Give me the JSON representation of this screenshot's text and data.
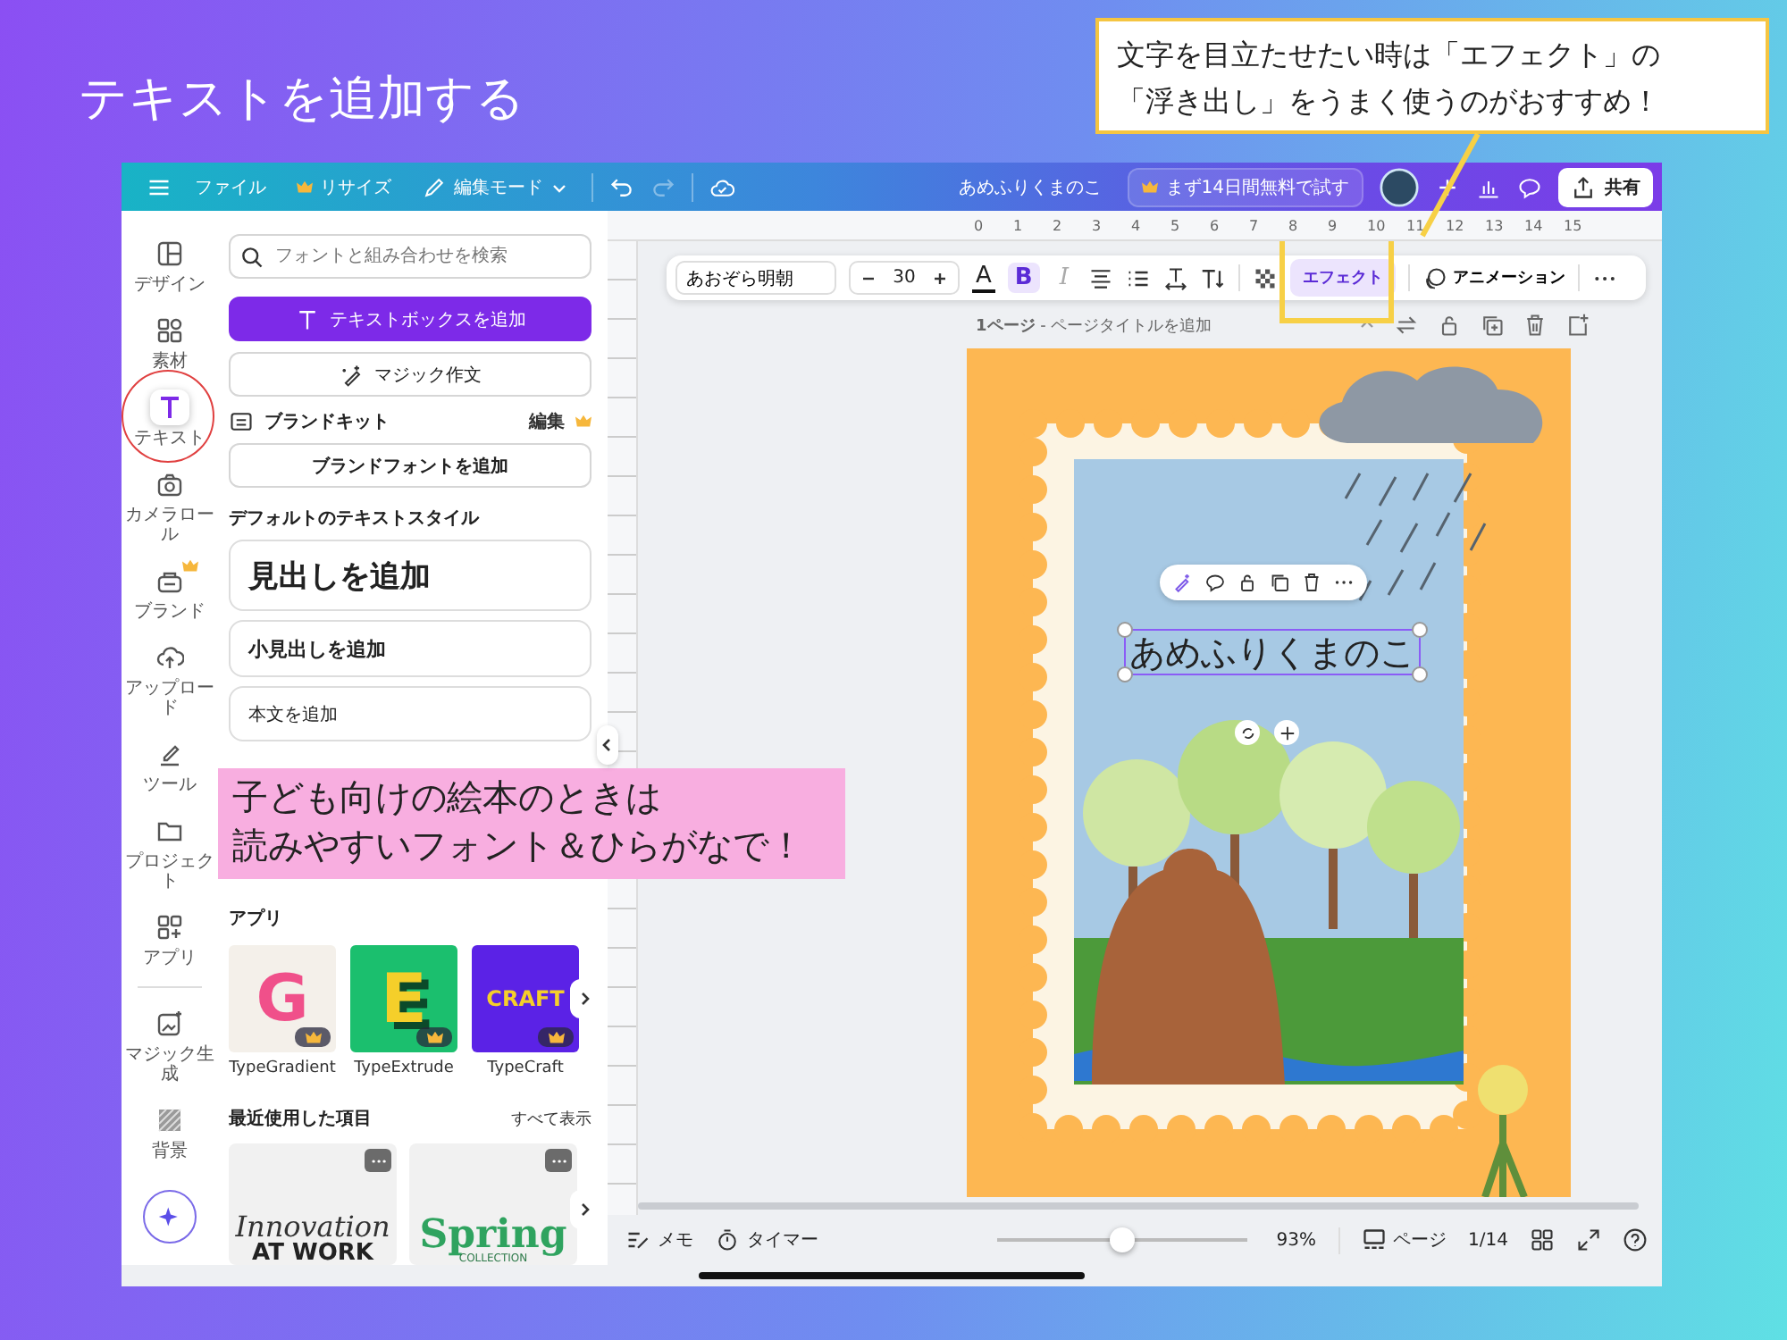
{
  "heading": "テキストを追加する",
  "callout": [
    "文字を目立たせたい時は「エフェクト」の",
    "「浮き出し」をうまく使うのがおすすめ！"
  ],
  "note": [
    "子ども向けの絵本のときは",
    "読みやすいフォント＆ひらがなで！"
  ],
  "topbar": {
    "menu": [
      {
        "label": "ファイル",
        "crown": false
      },
      {
        "label": "リサイズ",
        "crown": true
      }
    ],
    "mode": "編集モード",
    "doc_title": "あめふりくまのこ",
    "trial": "まず14日間無料で試す",
    "share": "共有"
  },
  "rail": [
    {
      "label": "デザイン",
      "kind": "layout",
      "selected": false,
      "crown": false,
      "circled": false
    },
    {
      "label": "素材",
      "kind": "elements",
      "selected": false,
      "crown": false,
      "circled": false
    },
    {
      "label": "テキスト",
      "kind": "text",
      "selected": true,
      "crown": false,
      "circled": true
    },
    {
      "label": "カメラロール",
      "kind": "camera",
      "selected": false,
      "crown": false,
      "circled": false
    },
    {
      "label": "ブランド",
      "kind": "brand",
      "selected": false,
      "crown": true,
      "circled": false
    },
    {
      "label": "アップロード",
      "kind": "upload",
      "selected": false,
      "crown": false,
      "circled": false
    },
    {
      "label": "ツール",
      "kind": "tools",
      "selected": false,
      "crown": false,
      "circled": false
    },
    {
      "label": "プロジェクト",
      "kind": "folder",
      "selected": false,
      "crown": false,
      "circled": false
    },
    {
      "label": "アプリ",
      "kind": "apps",
      "selected": false,
      "crown": false,
      "circled": false
    }
  ],
  "rail_extra": [
    {
      "label": "マジック生成",
      "kind": "magic",
      "selected": false,
      "crown": false,
      "circled": false
    },
    {
      "label": "背景",
      "kind": "pattern",
      "selected": false,
      "crown": false,
      "circled": false
    }
  ],
  "panel": {
    "search": {
      "placeholder": "フォントと組み合わせを検索"
    },
    "add_textbox": "テキストボックスを追加",
    "magic_write": "マジック作文",
    "brand_kit": {
      "title": "ブランドキット",
      "edit": "編集",
      "crown": true
    },
    "brand_font": "ブランドフォントを追加",
    "styles_title": "デフォルトのテキストスタイル",
    "styles": [
      {
        "kind": "heading",
        "label": "見出しを追加"
      },
      {
        "kind": "subheading",
        "label": "小見出しを追加"
      },
      {
        "kind": "body",
        "label": "本文を追加"
      }
    ],
    "apps_title": "アプリ",
    "apps": [
      {
        "name": "TypeGradient",
        "kind": "gradient",
        "art": "G",
        "crown": true
      },
      {
        "name": "TypeExtrude",
        "kind": "extrude",
        "art": "E",
        "crown": true
      },
      {
        "name": "TypeCraft",
        "kind": "craft",
        "art": "CRAFT",
        "crown": true
      }
    ],
    "recent_title": "最近使用した項目",
    "see_all": "すべて表示",
    "recent": [
      {
        "kind": "serif",
        "lines": [
          "Innovation",
          "AT WORK"
        ]
      },
      {
        "kind": "spring",
        "lines": [
          "Spring",
          "COLLECTION"
        ]
      }
    ]
  },
  "ruler": [
    "0",
    "1",
    "2",
    "3",
    "4",
    "5",
    "6",
    "7",
    "8",
    "9",
    "10",
    "11",
    "12",
    "13",
    "14",
    "15"
  ],
  "toolbar": {
    "font": "あおぞら明朝",
    "size": "30",
    "color_letter": "A",
    "bold": {
      "label": "B",
      "selected": true
    },
    "italic": {
      "label": "I",
      "disabled": true
    },
    "effect": {
      "label": "エフェクト",
      "selected": true,
      "highlighted": true
    },
    "animation": "アニメーション"
  },
  "page_bar": "**1ページ** - ページタイトルを追加",
  "canvas_text": "あめふりくまのこ",
  "bottom": {
    "memo": "メモ",
    "timer": "タイマー",
    "zoom": {
      "level": 0.5
    },
    "zoom_reading": "93%",
    "pages": "ページ",
    "page_count": "1/14"
  }
}
